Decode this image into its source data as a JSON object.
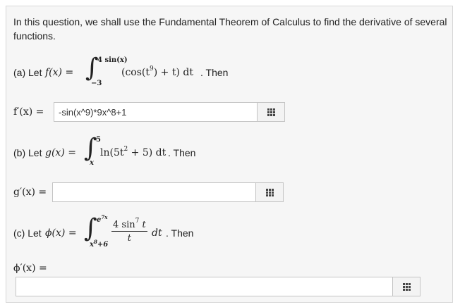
{
  "intro": "In this question, we shall use the Fundamental Theorem of Calculus to find the derivative of several functions.",
  "part_a": {
    "prefix": "(a) Let",
    "func": "f(x) =",
    "upper": "4 sin(x)",
    "lower": "−3",
    "integrand": "(cos(t",
    "exp": "9",
    "integrand_tail": ") + t) dt",
    "suffix": ". Then",
    "answer_label": "f′(x) =",
    "answer_value": "-sin(x^9)*9x^8+1"
  },
  "part_b": {
    "prefix": "(b) Let",
    "func": "g(x) =",
    "upper": "5",
    "lower": "x",
    "integrand": "ln(5t",
    "exp": "2",
    "integrand_tail": " + 5) dt",
    "suffix": ". Then",
    "answer_label": "g′(x) =",
    "answer_value": ""
  },
  "part_c": {
    "prefix": "(c) Let",
    "func": "ϕ(x) =",
    "upper": "e",
    "upper_exp": "7x",
    "lower": "x",
    "lower_exp": "8",
    "lower_tail": "+6",
    "numerator": "4 sin",
    "num_exp": "7",
    "num_tail": " t",
    "denominator": "t",
    "dt": "dt",
    "suffix": ". Then",
    "answer_label": "ϕ′(x) =",
    "answer_value": ""
  }
}
